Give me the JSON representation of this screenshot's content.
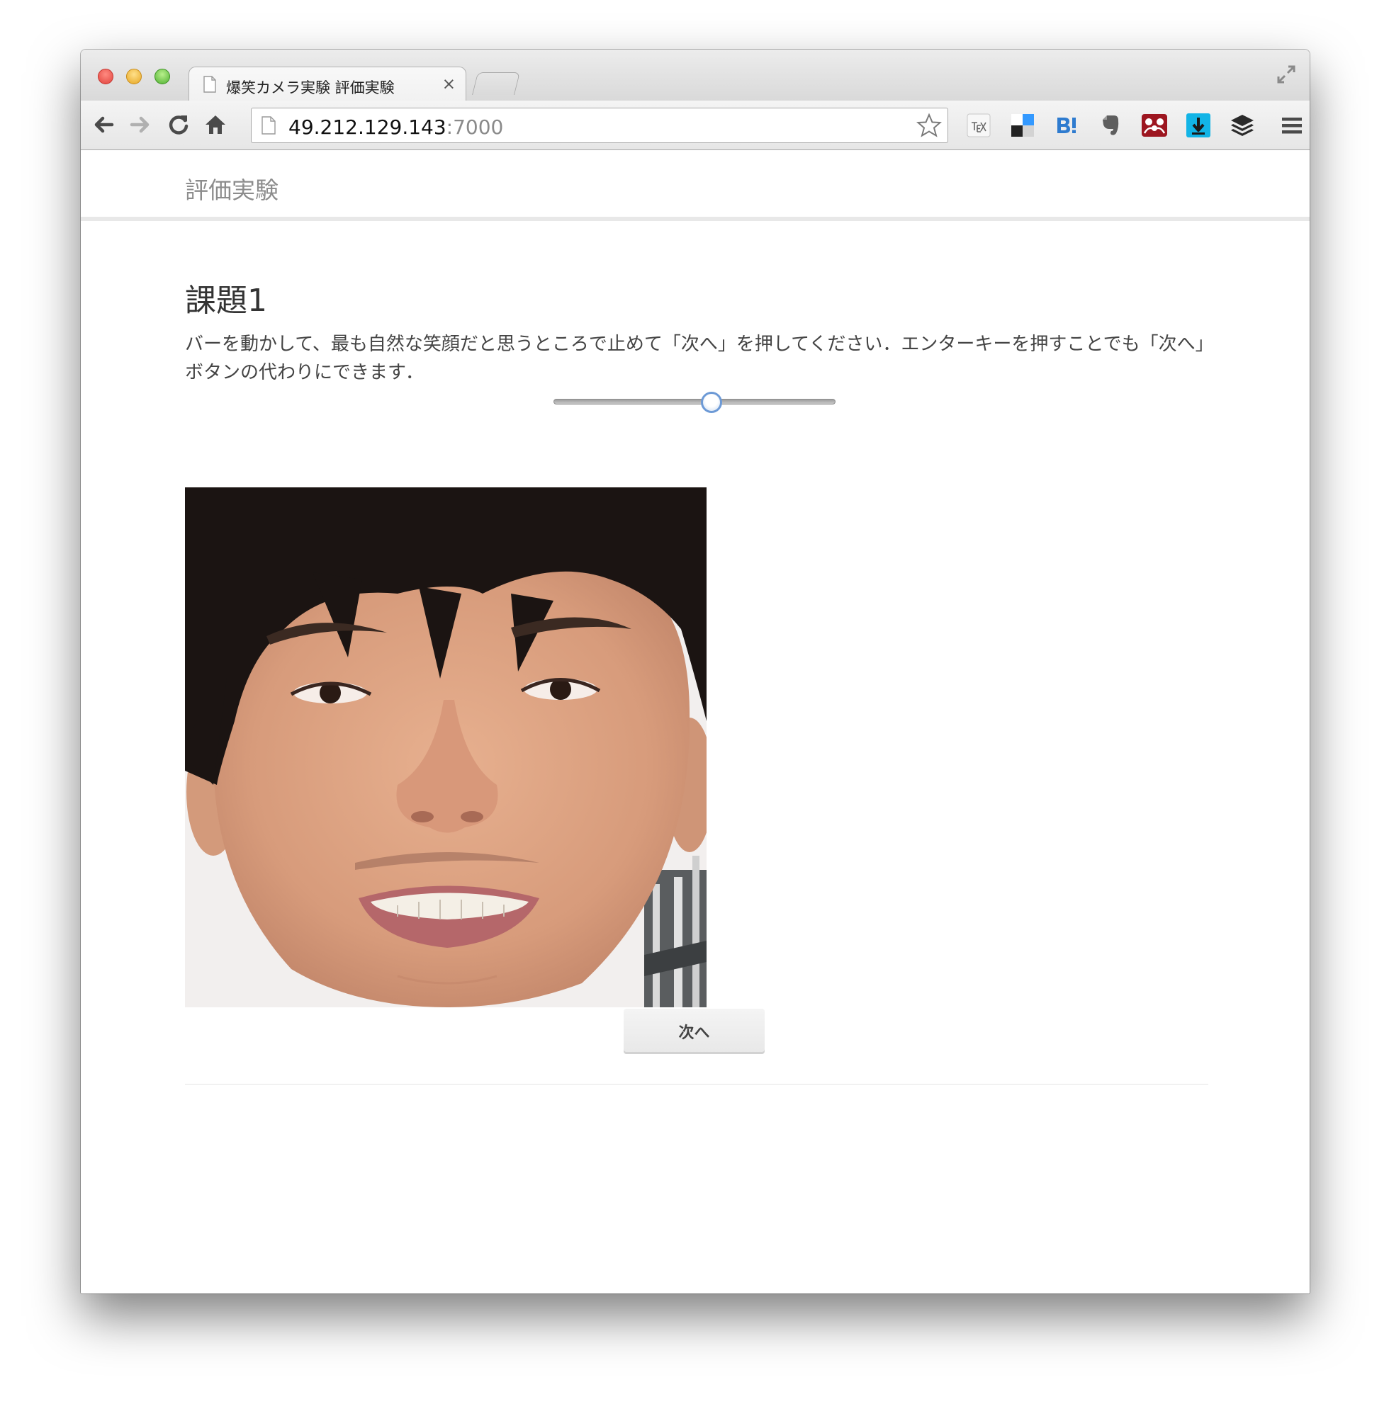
{
  "browser": {
    "tab_title": "爆笑カメラ実験 評価実験",
    "tab_close": "×",
    "url_host": "49.212.129.143",
    "url_port": ":7000"
  },
  "site": {
    "brand": "評価実験"
  },
  "task": {
    "title": "課題1",
    "instructions": "バーを動かして、最も自然な笑顔だと思うところで止めて「次へ」を押してください．エンターキーを押すことでも「次へ」ボタンの代わりにできます．",
    "slider_value": 0.56,
    "next_button": "次へ"
  },
  "icons": [
    "back-icon",
    "forward-icon",
    "reload-icon",
    "home-icon",
    "page-icon",
    "star-icon",
    "tex-extension-icon",
    "delicious-extension-icon",
    "hatena-bookmark-icon",
    "evernote-icon",
    "mendeley-icon",
    "download-icon",
    "buffer-icon",
    "menu-icon",
    "fullscreen-icon"
  ],
  "colors": {
    "slider_thumb_border": "#6d9ad6",
    "hatena_blue": "#2e7bcf",
    "download_cyan": "#12b4e6"
  }
}
